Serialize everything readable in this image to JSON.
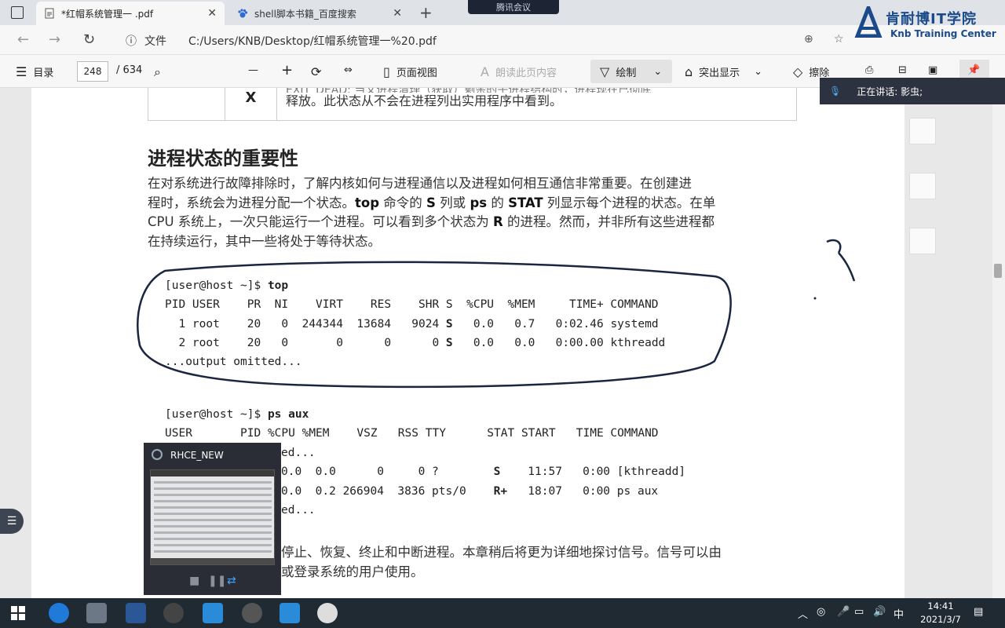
{
  "tabs": [
    {
      "label": "*红帽系统管理一 .pdf"
    },
    {
      "label": "shell脚本书籍_百度搜索"
    }
  ],
  "meeting_badge": "腾讯会议",
  "address": {
    "info_label": "文件",
    "url": "C:/Users/KNB/Desktop/红帽系统管理一%20.pdf"
  },
  "logo": {
    "cn": "肯耐博IT学院",
    "en": "Knb Training Center"
  },
  "pdf_toolbar": {
    "contents": "目录",
    "page_current": "248",
    "page_total": "/ 634",
    "page_view": "页面视图",
    "read_aloud": "朗读此页内容",
    "draw": "绘制",
    "highlight": "突出显示",
    "erase": "擦除"
  },
  "speaking": {
    "label": "正在讲话: 影虫;"
  },
  "doc": {
    "table_state": "X",
    "table_desc_clip": "EXIT_DEAD: 当父进程清理（获取）剩余的子进程结构时，进程现在已彻底",
    "table_desc": "释放。此状态从不会在进程列出实用程序中看到。",
    "heading": "进程状态的重要性",
    "para_1": "在对系统进行故障排除时，了解内核如何与进程通信以及进程如何相互通信非常重要。在创建进",
    "para_2a": "程时，系统会为进程分配一个状态。",
    "para_2b": "top",
    "para_2c": " 命令的 ",
    "para_2d": "S",
    "para_2e": " 列或 ",
    "para_2f": "ps",
    "para_2g": " 的 ",
    "para_2h": "STAT",
    "para_2i": " 列显示每个进程的状态。在单",
    "para_3a": "CPU 系统上，一次只能运行一个进程。可以看到多个状态为 ",
    "para_3b": "R",
    "para_3c": " 的进程。然而，并非所有这些进程都",
    "para_4": "在持续运行，其中一些将处于等待状态。",
    "top_prompt": "[user@host ~]$ ",
    "top_cmd": "top",
    "top_header": "PID USER    PR  NI    VIRT    RES    SHR S  %CPU  %MEM     TIME+ COMMAND",
    "top_row1": "  1 root    20   0  244344  13684   9024 ",
    "top_row1_s": "S",
    "top_row1_rest": "   0.0   0.7   0:02.46 systemd",
    "top_row2": "  2 root    20   0       0      0      0 ",
    "top_row2_s": "S",
    "top_row2_rest": "   0.0   0.0   0:00.00 kthreadd",
    "top_omit": "...output omitted...",
    "ps_prompt": "[user@host ~]$ ",
    "ps_cmd": "ps aux",
    "ps_header": "USER       PID %CPU %MEM    VSZ   RSS TTY      STAT START   TIME COMMAND",
    "ps_omit1": "ed...",
    "ps_row1": "0.0  0.0      0     0 ?        ",
    "ps_row1_stat": "S",
    "ps_row1_rest": "    11:57   0:00 [kthreadd]",
    "ps_row2": "0.0  0.2 266904  3836 pts/0    ",
    "ps_row2_stat": "R+",
    "ps_row2_rest": "   18:07   0:00 ps aux",
    "ps_omit2": "ed...",
    "para_5": "停止、恢复、终止和中断进程。本章稍后将更为详细地探讨信号。信号可以由",
    "para_6": "或登录系统的用户使用。"
  },
  "thumbnail": {
    "title": "RHCE_NEW"
  },
  "clock": {
    "time": "14:41",
    "date": "2021/3/7"
  },
  "taskbar": {
    "ime": "中"
  }
}
